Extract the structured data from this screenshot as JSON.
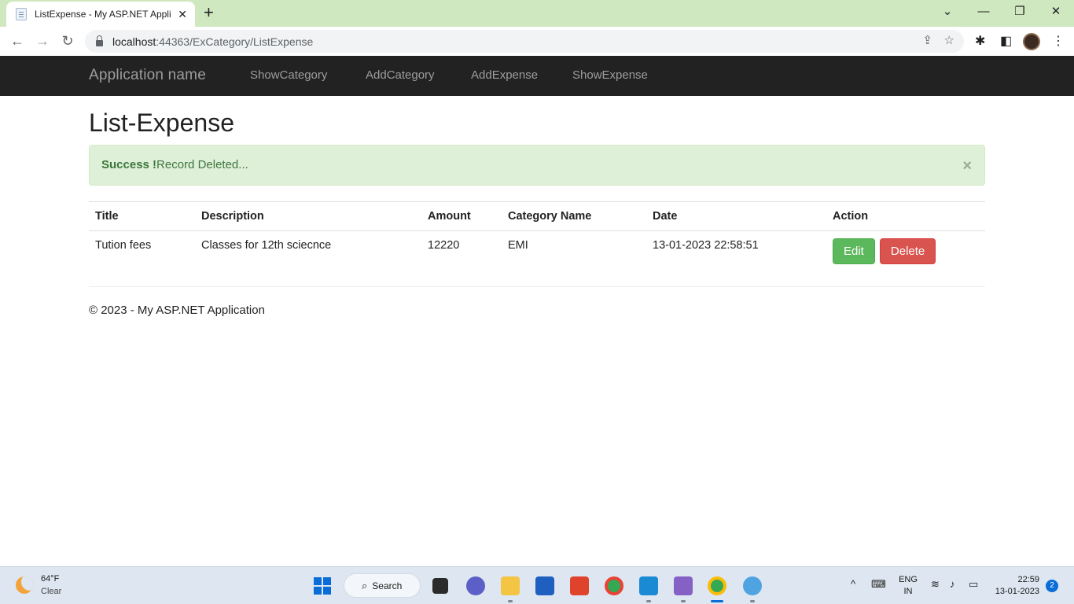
{
  "browser": {
    "tab_title": "ListExpense - My ASP.NET Applic",
    "tab_close": "✕",
    "new_tab": "+",
    "url_host": "localhost",
    "url_rest": ":44363/ExCategory/ListExpense"
  },
  "site": {
    "brand": "Application name",
    "nav": [
      "ShowCategory",
      "AddCategory",
      "AddExpense",
      "ShowExpense"
    ]
  },
  "page": {
    "title": "List-Expense",
    "alert": {
      "strong": "Success !",
      "message": "Record Deleted...",
      "close": "×"
    },
    "table": {
      "headers": [
        "Title",
        "Description",
        "Amount",
        "Category Name",
        "Date",
        "Action"
      ],
      "rows": [
        {
          "title": "Tution fees",
          "description": "Classes for 12th sciecnce",
          "amount": "12220",
          "category": "EMI",
          "date": "13-01-2023 22:58:51",
          "edit_label": "Edit",
          "delete_label": "Delete"
        }
      ]
    },
    "footer": "© 2023 - My ASP.NET Application"
  },
  "taskbar": {
    "weather_temp": "64°F",
    "weather_condition": "Clear",
    "search_label": "Search",
    "lang_1": "ENG",
    "lang_2": "IN",
    "time": "22:59",
    "date": "13-01-2023",
    "notifications": "2"
  },
  "colors": {
    "navbar": "#222222",
    "alert_bg": "#dff0d8",
    "edit_button": "#5cb85c",
    "delete_button": "#d9534f"
  }
}
